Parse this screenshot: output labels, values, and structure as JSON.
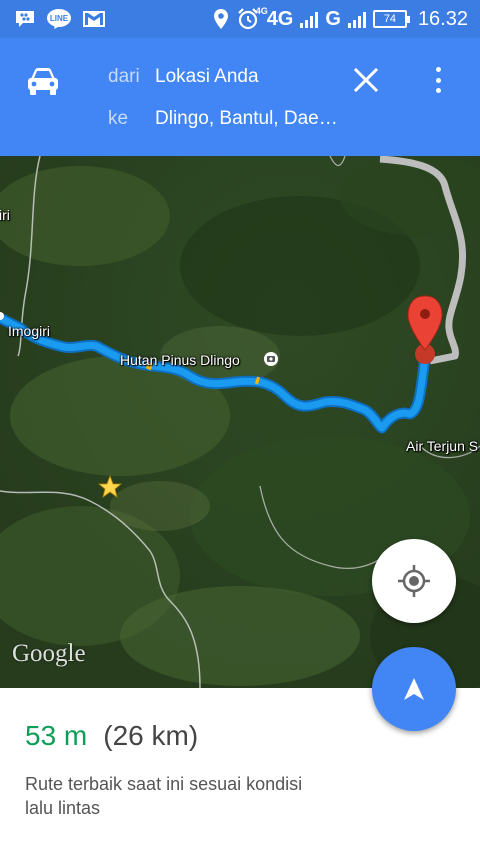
{
  "status_bar": {
    "left_icons": [
      "bbm-icon",
      "line-icon",
      "gmail-icon"
    ],
    "line_label": "LINE",
    "right_icons": [
      "location-icon",
      "alarm-icon",
      "signal-icon",
      "signal-icon"
    ],
    "network_1": "4G",
    "network_1_sup": "4G",
    "network_2": "G",
    "battery": "74",
    "time": "16.32"
  },
  "header": {
    "mode_icon": "car-icon",
    "from_label": "dari",
    "from_value": "Lokasi Anda",
    "to_label": "ke",
    "to_value": "Dlingo, Bantul, Dae…",
    "close_icon": "close-icon",
    "menu_icon": "more-vert-icon"
  },
  "map": {
    "labels": {
      "imogiri": "Imogiri",
      "hutan_pinus": "Hutan Pinus Dlingo",
      "air_terjun": "Air Terjun S",
      "edge_left": "iri"
    },
    "logo": "Google",
    "route_color": "#1a9bf0",
    "destination_pin_color": "#db4437",
    "star_color": "#ffd54f"
  },
  "controls": {
    "locate_icon": "my-location-icon",
    "navigate_icon": "navigation-arrow-icon",
    "accent": "#4285f4"
  },
  "sheet": {
    "time": "53 m",
    "distance": "(26 km)",
    "note": "Rute terbaik saat ini sesuai kondisi lalu lintas",
    "time_color": "#0f9d58"
  }
}
